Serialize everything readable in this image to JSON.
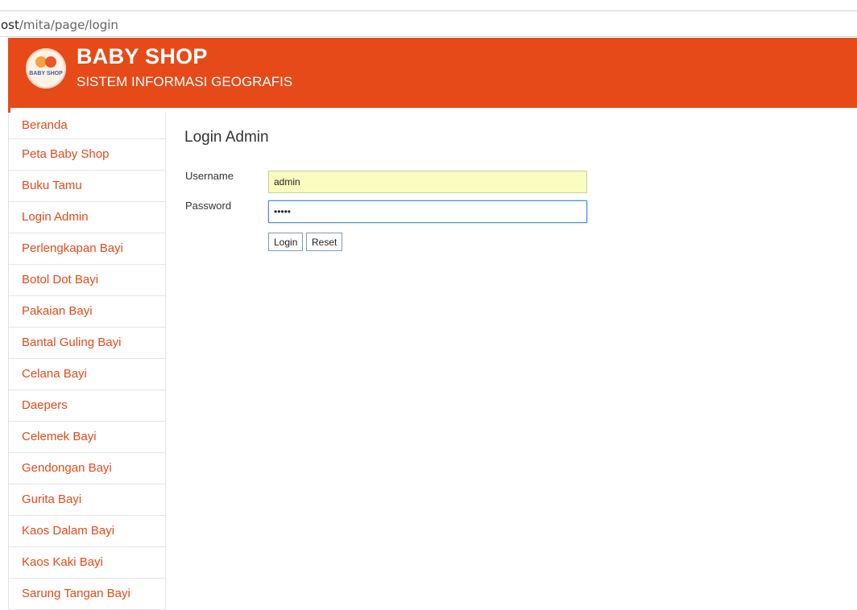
{
  "browser": {
    "url_host": "ost",
    "url_path": "/mita/page/login"
  },
  "header": {
    "logo_text": "BABY SHOP",
    "title": "BABY SHOP",
    "subtitle": "SISTEM INFORMASI GEOGRAFIS",
    "brand_color": "#e64a19"
  },
  "sidebar": {
    "items": [
      {
        "label": "Beranda"
      },
      {
        "label": "Peta Baby Shop"
      },
      {
        "label": "Buku Tamu"
      },
      {
        "label": "Login Admin"
      },
      {
        "label": "Perlengkapan Bayi"
      },
      {
        "label": "Botol Dot Bayi"
      },
      {
        "label": "Pakaian Bayi"
      },
      {
        "label": "Bantal Guling Bayi"
      },
      {
        "label": "Celana Bayi"
      },
      {
        "label": "Daepers"
      },
      {
        "label": "Celemek Bayi"
      },
      {
        "label": "Gendongan Bayi"
      },
      {
        "label": "Gurita Bayi"
      },
      {
        "label": "Kaos Dalam Bayi"
      },
      {
        "label": "Kaos Kaki Bayi"
      },
      {
        "label": "Sarung Tangan Bayi"
      }
    ]
  },
  "login": {
    "heading": "Login Admin",
    "username_label": "Username",
    "username_value": "admin",
    "password_label": "Password",
    "password_value": "•••••",
    "login_button": "Login",
    "reset_button": "Reset"
  }
}
